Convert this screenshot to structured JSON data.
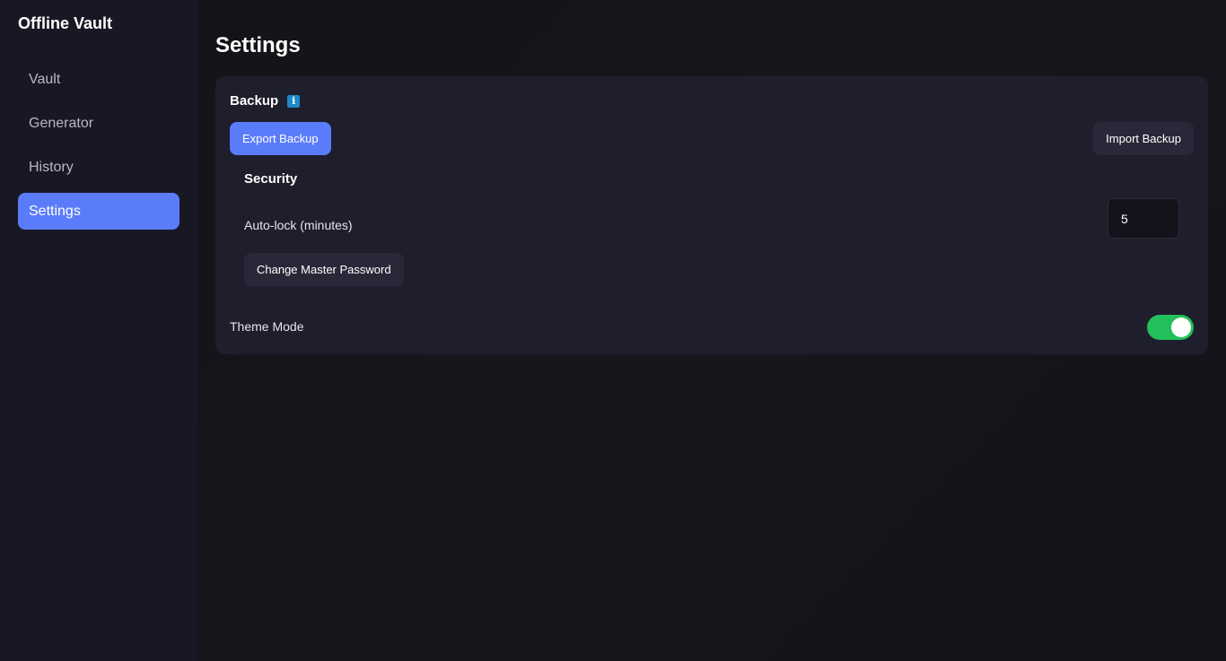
{
  "app": {
    "title": "Offline Vault"
  },
  "sidebar": {
    "items": [
      {
        "label": "Vault",
        "active": false
      },
      {
        "label": "Generator",
        "active": false
      },
      {
        "label": "History",
        "active": false
      },
      {
        "label": "Settings",
        "active": true
      }
    ]
  },
  "page": {
    "title": "Settings"
  },
  "backup": {
    "title": "Backup",
    "info_icon": "info-icon",
    "export_label": "Export Backup",
    "import_label": "Import Backup"
  },
  "security": {
    "title": "Security",
    "autolock_label": "Auto-lock (minutes)",
    "autolock_value": "5",
    "change_password_label": "Change Master Password"
  },
  "theme": {
    "label": "Theme Mode",
    "enabled": true
  },
  "colors": {
    "accent": "#5b7cfa",
    "toggle_on": "#22c05a",
    "info": "#1e88c8"
  }
}
